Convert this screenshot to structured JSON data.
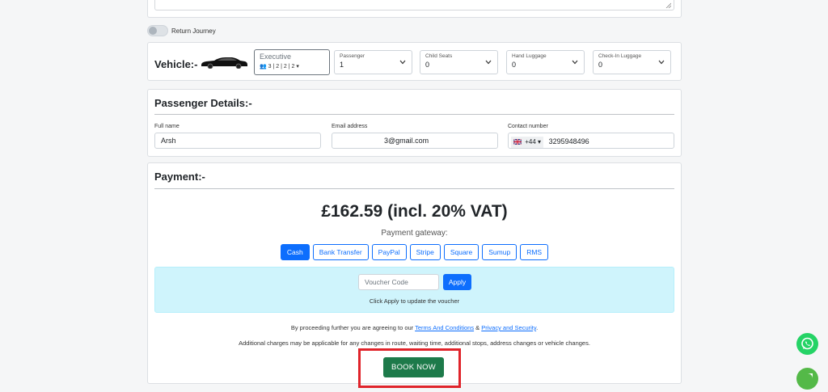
{
  "return_journey": {
    "label": "Return Journey"
  },
  "vehicle": {
    "title": "Vehicle:-",
    "selected": {
      "name": "Executive",
      "capacity": "3 | 2 | 2 | 2"
    },
    "passenger": {
      "label": "Passenger",
      "value": "1"
    },
    "child_seats": {
      "label": "Child Seats",
      "value": "0"
    },
    "hand_luggage": {
      "label": "Hand Luggage",
      "value": "0"
    },
    "checkin_luggage": {
      "label": "Check-In Luggage",
      "value": "0"
    }
  },
  "passenger_details": {
    "title": "Passenger Details:-",
    "full_name": {
      "label": "Full name",
      "value": "Arsh"
    },
    "email": {
      "label": "Email address",
      "value": "3@gmail.com"
    },
    "contact": {
      "label": "Contact number",
      "dial_code": "+44",
      "value": "3295948496"
    }
  },
  "payment": {
    "title": "Payment:-",
    "price": "£162.59 (incl. 20% VAT)",
    "gateway_label": "Payment gateway:",
    "gateways": [
      "Cash",
      "Bank Transfer",
      "PayPal",
      "Stripe",
      "Square",
      "Sumup",
      "RMS"
    ],
    "active_gateway": "Cash",
    "voucher": {
      "placeholder": "Voucher Code",
      "apply_label": "Apply",
      "hint": "Click Apply to update the voucher"
    },
    "terms": {
      "prefix": "By proceeding further you are agreeing to our ",
      "terms_link": "Terms And Conditions",
      "and": " & ",
      "privacy_link": "Privacy and Security",
      "suffix": "."
    },
    "charges_note": "Additional charges may be applicable for any changes in route, waiting time, additional stops, address changes or vehicle changes.",
    "book_label": "BOOK NOW"
  },
  "colors": {
    "primary": "#0d6efd",
    "book": "#1d7a4a",
    "highlight": "#e0242b",
    "voucher_bg": "#cff4fc",
    "whatsapp": "#25d366"
  }
}
